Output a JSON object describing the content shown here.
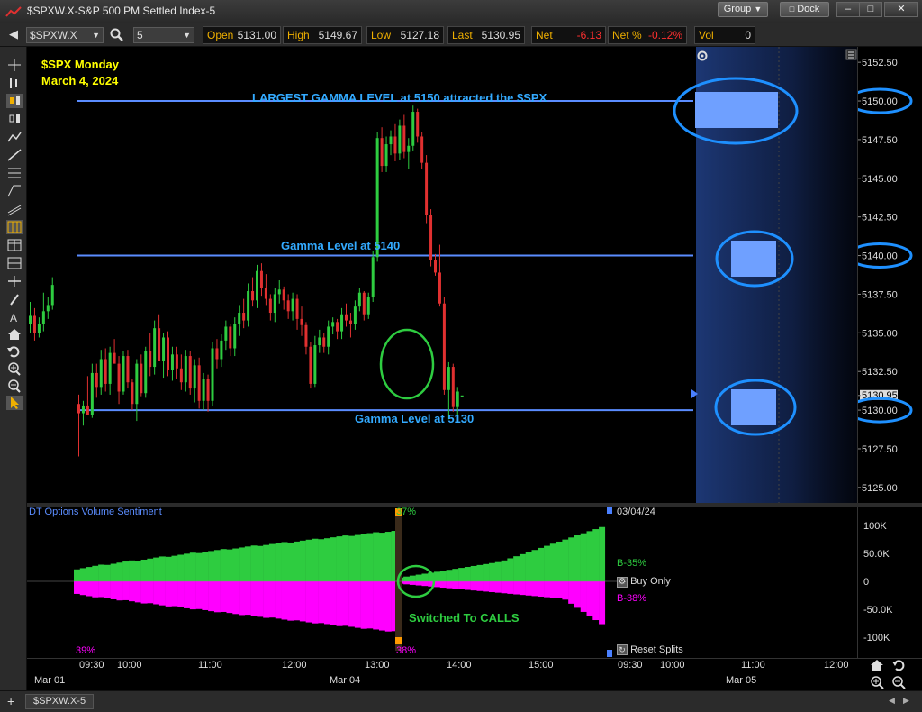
{
  "window": {
    "title": "$SPXW.X-S&P 500 PM Settled Index-5",
    "group_label": "Group",
    "dock_label": "Dock",
    "minimize_glyph": "–",
    "restore_glyph": "□",
    "close_glyph": "✕"
  },
  "toolbar": {
    "symbol": "$SPXW.X",
    "interval": "5",
    "open_label": "Open",
    "open_value": "5131.00",
    "high_label": "High",
    "high_value": "5149.67",
    "low_label": "Low",
    "low_value": "5127.18",
    "last_label": "Last",
    "last_value": "5130.95",
    "net_label": "Net",
    "net_value": "-6.13",
    "netpct_label": "Net %",
    "netpct_value": "-0.12%",
    "vol_label": "Vol",
    "vol_value": "0"
  },
  "annotations": {
    "date_line1": "$SPX Monday",
    "date_line2": "March 4, 2024",
    "largest_gamma": "LARGEST GAMMA LEVEL at 5150 attracted the $SPX",
    "gamma_5140": "Gamma Level at 5140",
    "gamma_5130": "Gamma Level at 5130",
    "switched": "Switched To CALLS"
  },
  "price_scale": {
    "labels": [
      "5152.50",
      "5150.00",
      "5147.50",
      "5145.00",
      "5142.50",
      "5140.00",
      "5137.50",
      "5135.00",
      "5132.50",
      "5130.95",
      "5130.00",
      "5127.50",
      "5125.00"
    ]
  },
  "indicator": {
    "title": "DT Options Volume Sentiment",
    "top_pct": "37%",
    "bottom_pct": "38%",
    "left_pct": "39%",
    "date_label": "03/04/24",
    "b_pos": "B-35%",
    "b_neg": "B-38%",
    "buy_only": "Buy Only",
    "reset_splits": "Reset Splits",
    "scale_labels": [
      "100K",
      "50.0K",
      "0",
      "-50.0K",
      "-100K"
    ]
  },
  "time_axis": {
    "times": [
      "09:30",
      "10:00",
      "11:00",
      "12:00",
      "13:00",
      "14:00",
      "15:00",
      "09:30",
      "10:00",
      "11:00",
      "12:00"
    ],
    "dates": [
      "Mar 01",
      "Mar 04",
      "Mar 05"
    ]
  },
  "status_tab": "$SPXW.X-5",
  "colors": {
    "up": "#2ecc40",
    "down": "#e03030",
    "gamma_line": "#5a8cff",
    "annotation_blue": "#33aaff",
    "annotation_yellow": "#ffff00",
    "annotation_green": "#2ecc40",
    "magenta": "#ff00ff"
  },
  "chart_data": {
    "type": "candlestick",
    "interval_minutes": 5,
    "gamma_levels": [
      5150,
      5140,
      5130
    ],
    "y_range": [
      5124,
      5153.5
    ],
    "candles": [
      [
        5135.6,
        5137.0,
        5135.0,
        5136.1
      ],
      [
        5136.1,
        5136.6,
        5134.5,
        5135.0
      ],
      [
        5135.0,
        5136.0,
        5134.7,
        5135.6
      ],
      [
        5135.6,
        5137.6,
        5135.1,
        5136.4
      ],
      [
        5136.4,
        5137.3,
        5135.9,
        5136.8
      ],
      [
        5136.8,
        5138.6,
        5136.5,
        5138.1
      ],
      [
        5130.4,
        5131.0,
        5127.0,
        5129.8
      ],
      [
        5129.8,
        5130.6,
        5129.0,
        5130.3
      ],
      [
        5130.3,
        5132.2,
        5129.8,
        5129.7
      ],
      [
        5129.7,
        5133.0,
        5129.5,
        5132.4
      ],
      [
        5132.4,
        5133.0,
        5130.8,
        5131.5
      ],
      [
        5131.5,
        5133.9,
        5131.0,
        5133.3
      ],
      [
        5133.3,
        5134.0,
        5131.2,
        5131.7
      ],
      [
        5131.7,
        5134.1,
        5131.0,
        5133.7
      ],
      [
        5133.7,
        5134.6,
        5133.1,
        5133.0
      ],
      [
        5133.0,
        5133.5,
        5130.4,
        5131.2
      ],
      [
        5131.2,
        5133.8,
        5131.0,
        5133.5
      ],
      [
        5133.5,
        5133.9,
        5131.4,
        5131.8
      ],
      [
        5131.8,
        5132.0,
        5130.0,
        5130.4
      ],
      [
        5130.4,
        5133.3,
        5129.3,
        5133.0
      ],
      [
        5133.0,
        5133.6,
        5130.9,
        5131.1
      ],
      [
        5131.1,
        5134.1,
        5130.8,
        5133.8
      ],
      [
        5133.8,
        5135.0,
        5132.2,
        5132.8
      ],
      [
        5132.8,
        5135.8,
        5132.3,
        5135.3
      ],
      [
        5135.3,
        5136.2,
        5133.7,
        5133.2
      ],
      [
        5133.2,
        5135.0,
        5132.1,
        5134.7
      ],
      [
        5134.7,
        5135.1,
        5132.2,
        5132.6
      ],
      [
        5132.6,
        5134.1,
        5131.9,
        5133.6
      ],
      [
        5133.6,
        5134.1,
        5132.0,
        5132.7
      ],
      [
        5132.7,
        5133.6,
        5131.3,
        5131.8
      ],
      [
        5131.8,
        5133.9,
        5131.2,
        5133.5
      ],
      [
        5133.5,
        5133.8,
        5131.0,
        5131.4
      ],
      [
        5131.4,
        5133.3,
        5130.5,
        5132.9
      ],
      [
        5132.9,
        5133.4,
        5130.1,
        5130.6
      ],
      [
        5130.6,
        5132.4,
        5130.0,
        5132.0
      ],
      [
        5132.0,
        5132.3,
        5129.9,
        5130.6
      ],
      [
        5130.6,
        5134.4,
        5130.3,
        5134.0
      ],
      [
        5134.0,
        5134.6,
        5132.7,
        5133.3
      ],
      [
        5133.3,
        5134.9,
        5132.8,
        5134.5
      ],
      [
        5134.5,
        5135.8,
        5133.9,
        5135.4
      ],
      [
        5135.4,
        5135.6,
        5133.5,
        5134.0
      ],
      [
        5134.0,
        5136.0,
        5133.5,
        5135.6
      ],
      [
        5135.6,
        5136.8,
        5134.8,
        5136.3
      ],
      [
        5136.3,
        5137.2,
        5135.3,
        5135.8
      ],
      [
        5135.8,
        5138.2,
        5135.4,
        5137.7
      ],
      [
        5137.7,
        5138.6,
        5136.7,
        5137.1
      ],
      [
        5137.1,
        5139.4,
        5136.6,
        5139.0
      ],
      [
        5139.0,
        5139.5,
        5137.4,
        5137.9
      ],
      [
        5137.9,
        5138.8,
        5136.8,
        5137.2
      ],
      [
        5137.2,
        5137.5,
        5135.8,
        5136.3
      ],
      [
        5136.3,
        5137.9,
        5135.7,
        5137.5
      ],
      [
        5137.5,
        5138.4,
        5136.9,
        5137.8
      ],
      [
        5137.8,
        5138.0,
        5136.5,
        5137.1
      ],
      [
        5137.1,
        5137.5,
        5135.9,
        5136.4
      ],
      [
        5136.4,
        5137.6,
        5135.8,
        5137.2
      ],
      [
        5137.2,
        5137.5,
        5135.2,
        5135.9
      ],
      [
        5135.9,
        5136.7,
        5134.8,
        5135.5
      ],
      [
        5135.5,
        5135.7,
        5133.6,
        5134.1
      ],
      [
        5134.1,
        5134.4,
        5131.4,
        5131.7
      ],
      [
        5131.7,
        5134.8,
        5131.5,
        5134.2
      ],
      [
        5134.2,
        5135.2,
        5133.7,
        5134.7
      ],
      [
        5134.7,
        5135.0,
        5133.7,
        5134.1
      ],
      [
        5134.1,
        5135.8,
        5133.6,
        5135.4
      ],
      [
        5135.4,
        5136.0,
        5134.9,
        5135.7
      ],
      [
        5135.7,
        5135.9,
        5134.6,
        5135.1
      ],
      [
        5135.1,
        5136.6,
        5134.6,
        5136.2
      ],
      [
        5136.2,
        5136.9,
        5135.4,
        5135.8
      ],
      [
        5135.8,
        5136.3,
        5134.7,
        5135.6
      ],
      [
        5135.6,
        5137.1,
        5135.2,
        5136.7
      ],
      [
        5136.7,
        5137.9,
        5136.4,
        5137.6
      ],
      [
        5137.6,
        5137.7,
        5135.8,
        5136.2
      ],
      [
        5136.2,
        5137.6,
        5135.9,
        5137.3
      ],
      [
        5137.3,
        5140.3,
        5137.0,
        5139.9
      ],
      [
        5139.9,
        5148.0,
        5139.6,
        5147.6
      ],
      [
        5147.6,
        5148.3,
        5145.4,
        5145.8
      ],
      [
        5145.8,
        5147.7,
        5145.4,
        5147.2
      ],
      [
        5147.2,
        5148.1,
        5146.5,
        5147.7
      ],
      [
        5147.7,
        5148.5,
        5146.1,
        5146.6
      ],
      [
        5146.6,
        5148.8,
        5146.2,
        5148.4
      ],
      [
        5148.4,
        5149.1,
        5146.3,
        5146.7
      ],
      [
        5146.7,
        5147.6,
        5145.6,
        5147.1
      ],
      [
        5147.1,
        5149.7,
        5146.8,
        5149.3
      ],
      [
        5149.3,
        5149.5,
        5147.3,
        5147.7
      ],
      [
        5147.7,
        5148.0,
        5145.6,
        5146.0
      ],
      [
        5146.0,
        5146.5,
        5142.1,
        5142.6
      ],
      [
        5142.6,
        5143.0,
        5139.3,
        5139.7
      ],
      [
        5139.7,
        5140.1,
        5138.7,
        5138.9
      ],
      [
        5138.9,
        5140.7,
        5136.7,
        5136.9
      ],
      [
        5136.9,
        5137.3,
        5131.0,
        5131.3
      ],
      [
        5131.3,
        5133.1,
        5129.4,
        5132.8
      ],
      [
        5132.8,
        5133.0,
        5129.9,
        5130.2
      ],
      [
        5130.2,
        5131.5,
        5129.6,
        5131.2
      ],
      [
        5130.95,
        5130.95,
        5130.95,
        5130.95
      ]
    ]
  }
}
